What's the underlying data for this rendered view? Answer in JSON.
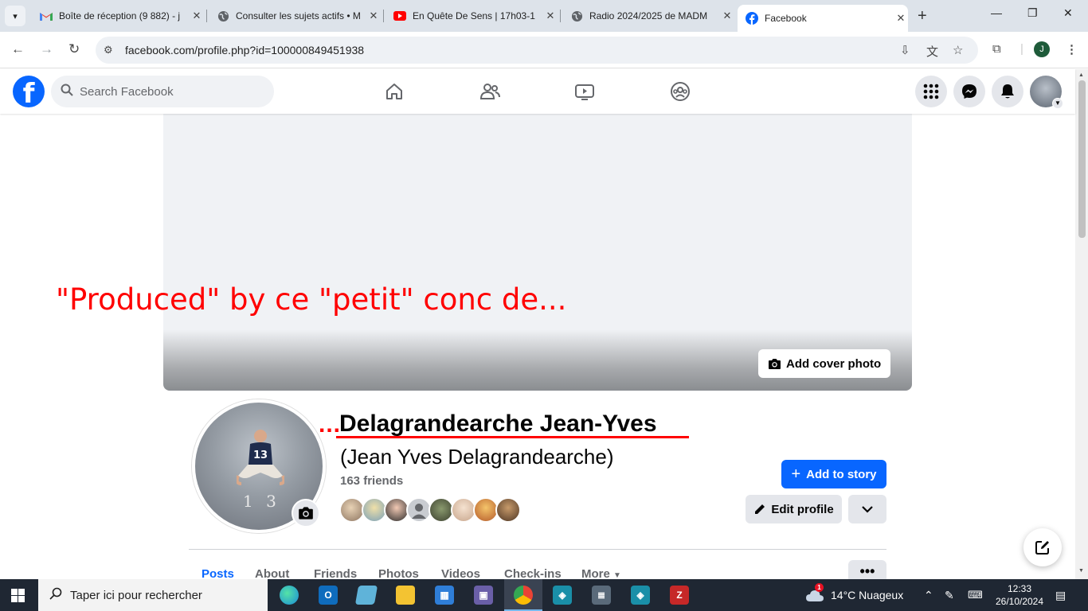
{
  "browser": {
    "tabs": [
      {
        "title": "Boîte de réception (9 882) - j",
        "icon": "gmail-icon"
      },
      {
        "title": "Consulter les sujets actifs • M",
        "icon": "globe-icon"
      },
      {
        "title": "En Quête De Sens | 17h03-1",
        "icon": "youtube-icon"
      },
      {
        "title": "Radio 2024/2025 de MADM",
        "icon": "globe-icon"
      },
      {
        "title": "Facebook",
        "icon": "facebook-icon",
        "active": true
      }
    ],
    "url": "facebook.com/profile.php?id=100000849451938",
    "profile_initial": "J"
  },
  "fb_header": {
    "search_placeholder": "Search Facebook"
  },
  "profile": {
    "overlay_caption": "\"Produced\" by ce \"petit\" conc de...",
    "name_prefix": "...",
    "name": "Delagrandearche Jean-Yves",
    "alternate_name": "(Jean Yves Delagrandearche)",
    "friends_count": "163 friends",
    "add_cover_label": "Add cover photo",
    "add_story_label": "Add to story",
    "edit_profile_label": "Edit profile",
    "picture_number": "13",
    "tabs": [
      "Posts",
      "About",
      "Friends",
      "Photos",
      "Videos",
      "Check-ins",
      "More"
    ],
    "active_tab": "Posts",
    "more_tabs_label": "•••"
  },
  "colors": {
    "fb_blue": "#0866ff",
    "annotation_red": "#ff0000"
  },
  "taskbar": {
    "search_placeholder": "Taper ici pour rechercher",
    "weather": "14°C  Nuageux",
    "weather_badge": "1",
    "time": "12:33",
    "date": "26/10/2024"
  }
}
